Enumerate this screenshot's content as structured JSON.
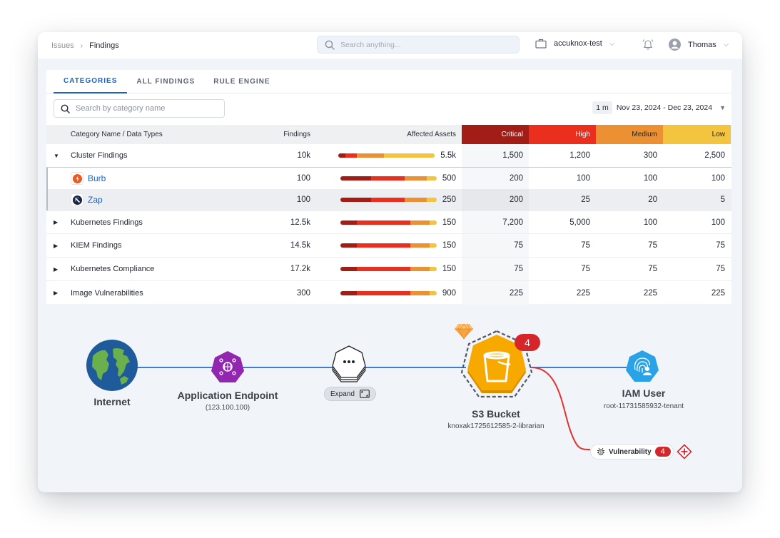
{
  "breadcrumb": {
    "parent": "Issues",
    "current": "Findings"
  },
  "header": {
    "search_placeholder": "Search anything...",
    "tenant": "accuknox-test",
    "user": "Thomas"
  },
  "tabs": [
    {
      "label": "CATEGORIES",
      "active": true
    },
    {
      "label": "ALL FINDINGS",
      "active": false
    },
    {
      "label": "RULE ENGINE",
      "active": false
    }
  ],
  "category_search_placeholder": "Search by category name",
  "date_filter": {
    "range_chip": "1 m",
    "range": "Nov 23, 2024 - Dec 23, 2024"
  },
  "severity_colors": {
    "critical": "#a31d17",
    "high": "#ea2f1f",
    "medium": "#ec9133",
    "low": "#f2c440"
  },
  "table": {
    "columns": {
      "name": "Category Name / Data Types",
      "findings": "Findings",
      "assets": "Affected Assets",
      "critical": "Critical",
      "high": "High",
      "medium": "Medium",
      "low": "Low"
    },
    "rows": [
      {
        "type": "parent",
        "expanded": true,
        "name": "Cluster Findings",
        "findings": "10k",
        "assets": "5.5k",
        "bar": [
          7,
          12,
          28,
          53
        ],
        "critical": "1,500",
        "high": "1,200",
        "medium": "300",
        "low": "2,500"
      },
      {
        "type": "child",
        "name": "Burb",
        "logo": "burp-icon",
        "findings": "100",
        "assets": "500",
        "bar": [
          32,
          35,
          23,
          10
        ],
        "critical": "200",
        "high": "100",
        "medium": "100",
        "low": "100"
      },
      {
        "type": "child",
        "name": "Zap",
        "logo": "zap-icon",
        "findings": "100",
        "assets": "250",
        "bar": [
          32,
          35,
          23,
          10
        ],
        "critical": "200",
        "high": "25",
        "medium": "20",
        "low": "5"
      },
      {
        "type": "parent",
        "expanded": false,
        "name": "Kubernetes Findings",
        "findings": "12.5k",
        "assets": "150",
        "bar": [
          17,
          56,
          20,
          7
        ],
        "critical": "7,200",
        "high": "5,000",
        "medium": "100",
        "low": "100"
      },
      {
        "type": "parent",
        "expanded": false,
        "name": "KIEM Findings",
        "findings": "14.5k",
        "assets": "150",
        "bar": [
          17,
          56,
          20,
          7
        ],
        "critical": "75",
        "high": "75",
        "medium": "75",
        "low": "75"
      },
      {
        "type": "parent",
        "expanded": false,
        "name": "Kubernetes Compliance",
        "findings": "17.2k",
        "assets": "150",
        "bar": [
          17,
          56,
          20,
          7
        ],
        "critical": "75",
        "high": "75",
        "medium": "75",
        "low": "75"
      },
      {
        "type": "parent",
        "expanded": false,
        "name": "Image Vulnerabilities",
        "findings": "300",
        "assets": "900",
        "bar": [
          17,
          56,
          20,
          7
        ],
        "critical": "225",
        "high": "225",
        "medium": "225",
        "low": "225"
      }
    ]
  },
  "graph": {
    "nodes": {
      "internet": {
        "label": "Internet"
      },
      "endpoint": {
        "label": "Application Endpoint",
        "sub": "(123.100.100)"
      },
      "collapsed": {
        "button": "Expand"
      },
      "bucket": {
        "label": "S3 Bucket",
        "sub": "knoxak1725612585-2-librarian",
        "badge": "4"
      },
      "iam": {
        "label": "IAM User",
        "sub": "root-11731585932-tenant"
      }
    },
    "vulnerability": {
      "label": "Vulnerability",
      "count": "4"
    }
  }
}
